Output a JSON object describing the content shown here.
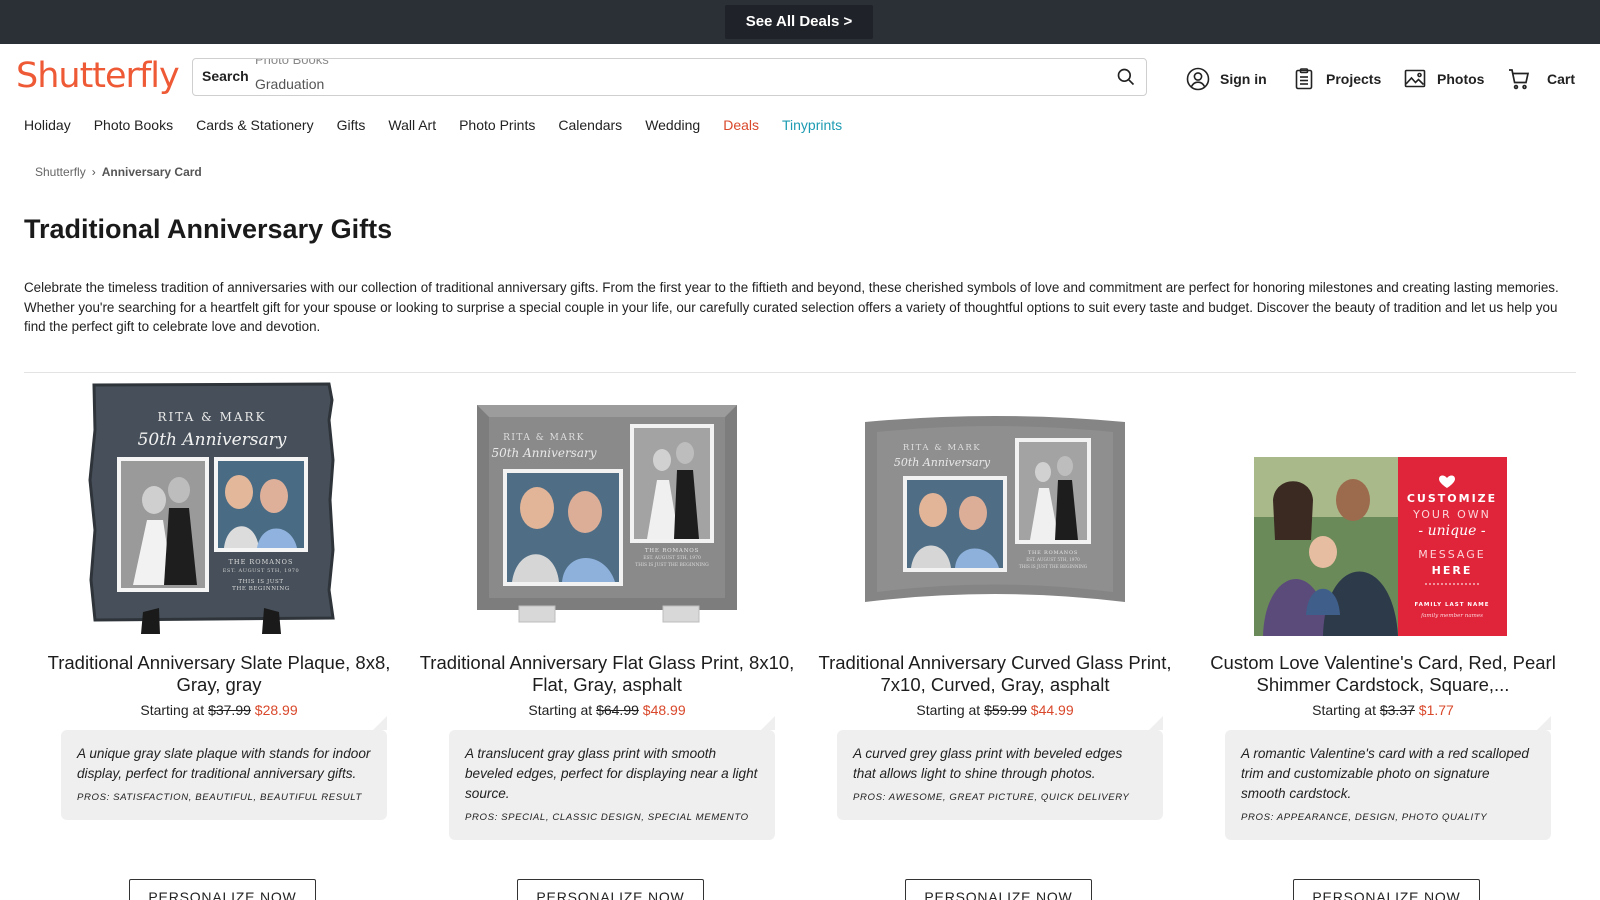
{
  "promo": {
    "label": "See All Deals >"
  },
  "header": {
    "logo": "Shutterfly",
    "search": {
      "label": "Search",
      "suggestion_prev": "Photo Books",
      "suggestion": "Graduation"
    },
    "links": {
      "signin": "Sign in",
      "projects": "Projects",
      "photos": "Photos",
      "cart": "Cart"
    }
  },
  "nav": [
    "Holiday",
    "Photo Books",
    "Cards & Stationery",
    "Gifts",
    "Wall Art",
    "Photo Prints",
    "Calendars",
    "Wedding",
    "Deals",
    "Tinyprints"
  ],
  "breadcrumb": {
    "root": "Shutterfly",
    "current": "Anniversary Card"
  },
  "page": {
    "title": "Traditional Anniversary Gifts",
    "intro": "Celebrate the timeless tradition of anniversaries with our collection of traditional anniversary gifts. From the first year to the fiftieth and beyond, these cherished symbols of love and commitment are perfect for honoring milestones and creating lasting memories. Whether you're searching for a heartfelt gift for your spouse or looking to surprise a special couple in your life, our carefully curated selection offers a variety of thoughtful options to suit every taste and budget. Discover the beauty of tradition and let us help you find the perfect gift to celebrate love and devotion."
  },
  "products": [
    {
      "title": "Traditional Anniversary Slate Plaque, 8x8, Gray, gray",
      "starting": "Starting at",
      "orig_price": "$37.99",
      "sale_price": "$28.99",
      "desc": "A unique gray slate plaque with stands for indoor display, perfect for traditional anniversary gifts.",
      "pros": "Pros: satisfaction, beautiful, beautiful result",
      "button": "PERSONALIZE NOW",
      "img": {
        "names": "RITA & MARK",
        "script": "50th Anniversary",
        "family": "THE ROMANOS",
        "est": "EST. AUGUST 5TH, 1970",
        "tag1": "THIS IS JUST",
        "tag2": "THE BEGINNING"
      }
    },
    {
      "title": "Traditional Anniversary Flat Glass Print, 8x10, Flat, Gray, asphalt",
      "starting": "Starting at",
      "orig_price": "$64.99",
      "sale_price": "$48.99",
      "desc": "A translucent gray glass print with smooth beveled edges, perfect for displaying near a light source.",
      "pros": "Pros: special, classic design, special memento",
      "button": "PERSONALIZE NOW",
      "img": {
        "names": "RITA & MARK",
        "script": "50th Anniversary",
        "family": "THE ROMANOS",
        "est": "EST. AUGUST 5TH, 1970",
        "tag1": "THIS IS JUST THE BEGINNING"
      }
    },
    {
      "title": "Traditional Anniversary Curved Glass Print, 7x10, Curved, Gray, asphalt",
      "starting": "Starting at",
      "orig_price": "$59.99",
      "sale_price": "$44.99",
      "desc": "A curved grey glass print with beveled edges that allows light to shine through photos.",
      "pros": "Pros: awesome, great picture, quick delivery",
      "button": "PERSONALIZE NOW",
      "img": {
        "names": "RITA & MARK",
        "script": "50th Anniversary",
        "family": "THE ROMANOS",
        "est": "EST. AUGUST 5TH, 1970",
        "tag1": "THIS IS JUST THE BEGINNING"
      }
    },
    {
      "title": "Custom Love Valentine's Card, Red, Pearl Shimmer Cardstock, Square,...",
      "starting": "Starting at",
      "orig_price": "$3.37",
      "sale_price": "$1.77",
      "desc": "A romantic Valentine's card with a red scalloped trim and customizable photo on signature smooth cardstock.",
      "pros": "Pros: appearance, design, photo quality",
      "button": "PERSONALIZE NOW",
      "img": {
        "l1": "CUSTOMIZE",
        "l2": "YOUR OWN",
        "l3": "- unique -",
        "l4": "MESSAGE",
        "l5": "HERE",
        "l6": "FAMILY LAST NAME",
        "l7": "family member names"
      }
    }
  ],
  "colors": {
    "brand": "#ef5a36",
    "sale": "#d9482b",
    "tinyprints": "#1d9bb2",
    "promo_bg": "#2b2f36"
  }
}
